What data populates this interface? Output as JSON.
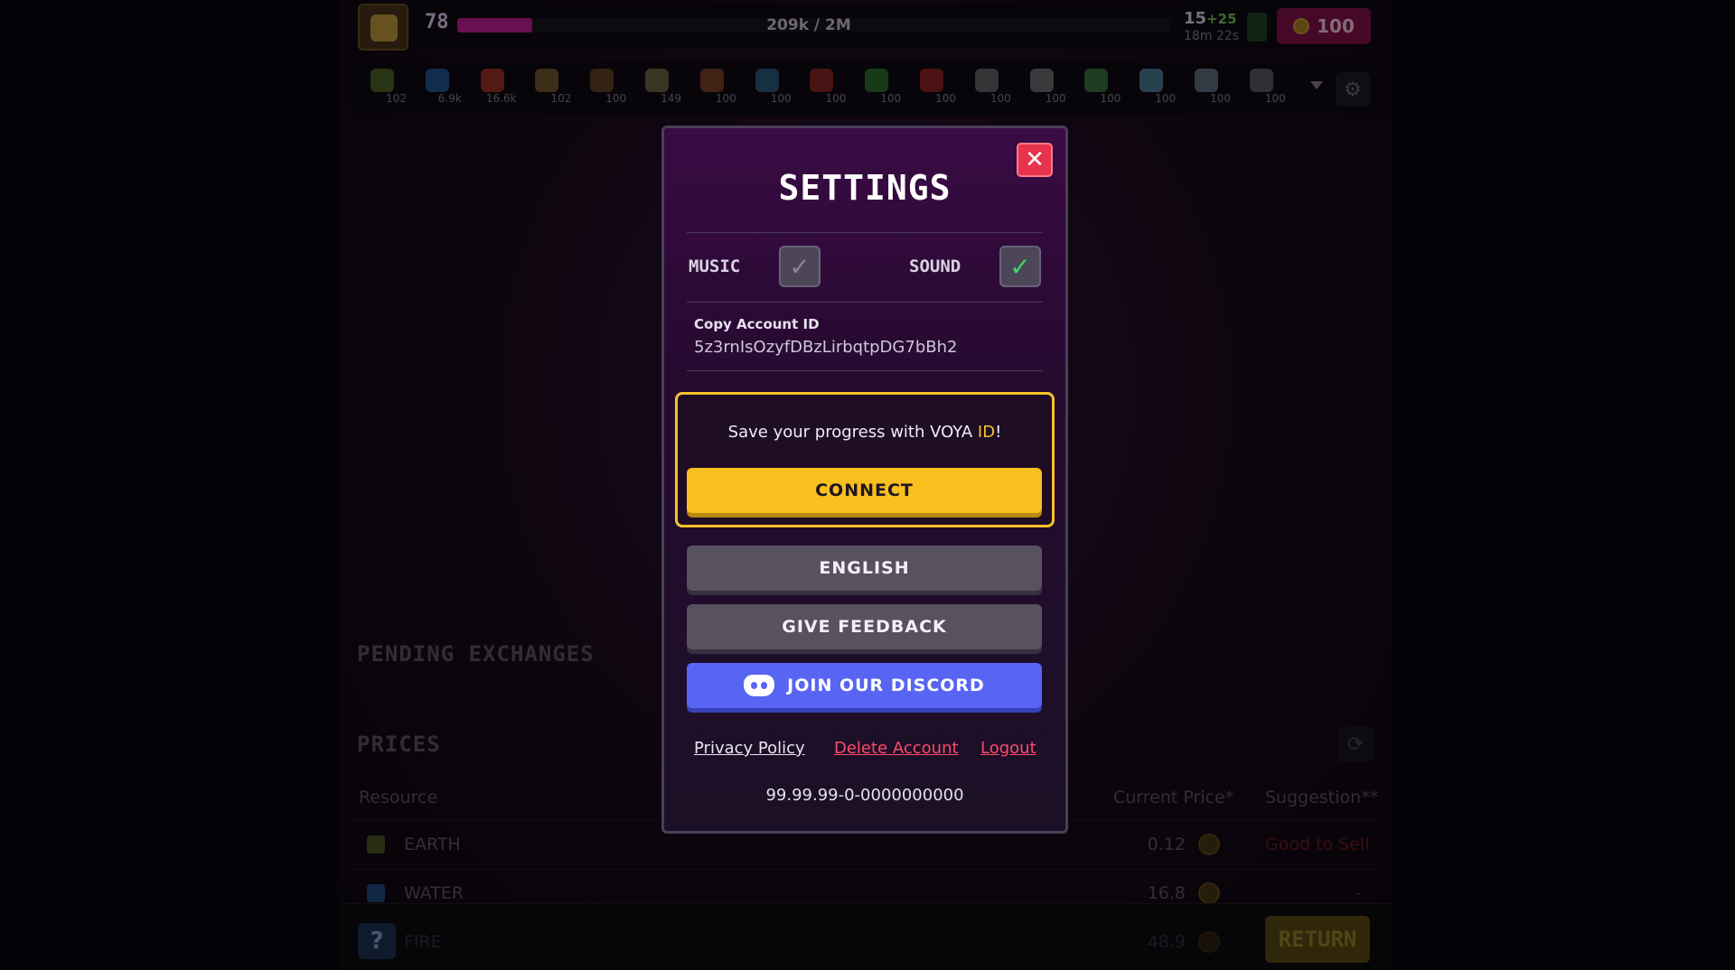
{
  "hud": {
    "level": "78",
    "xp_text": "209k / 2M",
    "xp_progress": 0.105,
    "energy": "15",
    "energy_bonus": "+25",
    "energy_timer": "18m 22s",
    "coins": "100"
  },
  "resources": [
    {
      "count": "102",
      "color": "#6b8a2a",
      "icon": "earth-icon"
    },
    {
      "count": "6.9k",
      "color": "#2a76c8",
      "icon": "water-icon"
    },
    {
      "count": "16.6k",
      "color": "#e0442a",
      "icon": "fire-icon"
    },
    {
      "count": "102",
      "color": "#a47a3a",
      "icon": "branch-icon"
    },
    {
      "count": "100",
      "color": "#8a5a30",
      "icon": "rock-icon"
    },
    {
      "count": "149",
      "color": "#9a8a5a",
      "icon": "pile-icon"
    },
    {
      "count": "100",
      "color": "#b05a30",
      "icon": "brick-icon"
    },
    {
      "count": "100",
      "color": "#3a7ab0",
      "icon": "crystal-icon"
    },
    {
      "count": "100",
      "color": "#c0302a",
      "icon": "sticks-icon"
    },
    {
      "count": "100",
      "color": "#3a9a3a",
      "icon": "plant-icon"
    },
    {
      "count": "100",
      "color": "#c82a2a",
      "icon": "berry-icon"
    },
    {
      "count": "100",
      "color": "#8a8a8a",
      "icon": "bottle-icon"
    },
    {
      "count": "100",
      "color": "#9a9a9a",
      "icon": "metal-icon"
    },
    {
      "count": "100",
      "color": "#4aa04a",
      "icon": "jar-icon"
    },
    {
      "count": "100",
      "color": "#6ab0d0",
      "icon": "glass-icon"
    },
    {
      "count": "100",
      "color": "#8a9ab0",
      "icon": "machine-icon"
    },
    {
      "count": "100",
      "color": "#7a7a8a",
      "icon": "tool-icon"
    }
  ],
  "background": {
    "pending_title": "PENDING EXCHANGES",
    "prices_title": "PRICES",
    "columns": [
      "Resource",
      "Current Price*",
      "Suggestion**"
    ],
    "rows": [
      {
        "name": "EARTH",
        "price": "0.12",
        "suggestion": "Good to Sell",
        "color": "#6b8a2a"
      },
      {
        "name": "WATER",
        "price": "16.8",
        "suggestion": "-",
        "color": "#2a76c8"
      },
      {
        "name": "FIRE",
        "price": "48.9",
        "suggestion": "",
        "color": "#e0442a"
      }
    ],
    "help_label": "?",
    "return_label": "RETURN"
  },
  "settings": {
    "title": "SETTINGS",
    "close_glyph": "✕",
    "music_label": "MUSIC",
    "music_enabled": false,
    "sound_label": "SOUND",
    "sound_enabled": true,
    "check_glyph": "✓",
    "copy_account_label": "Copy Account ID",
    "account_id": "5z3rnIsOzyfDBzLirbqtpDG7bBh2",
    "voya_text_prefix": "Save your progress with VOYA ",
    "voya_text_highlight": "ID",
    "voya_text_suffix": "!",
    "connect_label": "CONNECT",
    "language_label": "ENGLISH",
    "feedback_label": "GIVE FEEDBACK",
    "discord_label": "JOIN OUR DISCORD",
    "privacy_label": "Privacy Policy",
    "delete_label": "Delete Account",
    "logout_label": "Logout",
    "version": "99.99.99-0-0000000000"
  },
  "colors": {
    "accent_yellow": "#f9bf1e",
    "discord_blue": "#5865f2",
    "danger_red": "#e8334d",
    "link_red": "#ff4a6a",
    "check_green": "#3fd96a"
  }
}
